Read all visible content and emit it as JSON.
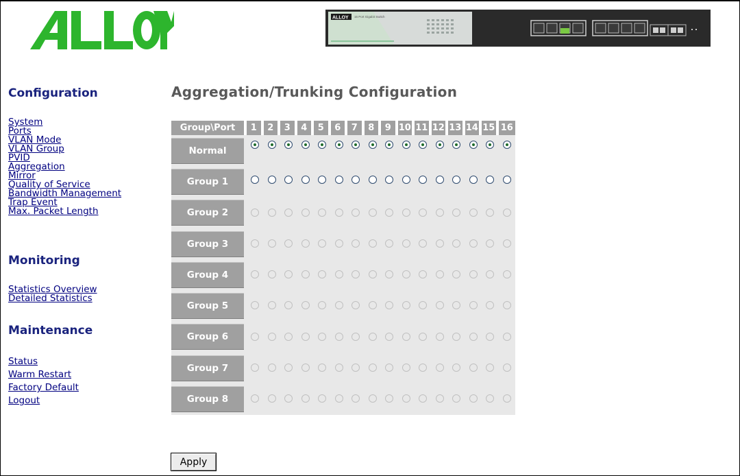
{
  "logo": {
    "text": "ALLOY",
    "color": "#2db52d"
  },
  "switch_image": {
    "label": "16 Port Gigabit Switch",
    "brand": "ALLOY"
  },
  "sidebar": {
    "configuration": {
      "heading": "Configuration",
      "links": [
        "System",
        "Ports",
        "VLAN Mode",
        "VLAN Group",
        "PVID",
        "Aggregation",
        "Mirror",
        "Quality of Service",
        "Bandwidth Management",
        "Trap Event",
        "Max. Packet Length"
      ]
    },
    "monitoring": {
      "heading": "Monitoring",
      "links": [
        "Statistics Overview",
        "Detailed Statistics"
      ]
    },
    "maintenance": {
      "heading": "Maintenance",
      "links": [
        "Status",
        "Warm Restart",
        "Factory Default",
        "Logout"
      ]
    }
  },
  "main": {
    "title": "Aggregation/Trunking Configuration",
    "table": {
      "corner_header": "Group\\Port",
      "ports": [
        "1",
        "2",
        "3",
        "4",
        "5",
        "6",
        "7",
        "8",
        "9",
        "10",
        "11",
        "12",
        "13",
        "14",
        "15",
        "16"
      ],
      "rows": [
        {
          "label": "Normal",
          "state": "checked"
        },
        {
          "label": "Group 1",
          "state": "enabled"
        },
        {
          "label": "Group 2",
          "state": "disabled"
        },
        {
          "label": "Group 3",
          "state": "disabled"
        },
        {
          "label": "Group 4",
          "state": "disabled"
        },
        {
          "label": "Group 5",
          "state": "disabled"
        },
        {
          "label": "Group 6",
          "state": "disabled"
        },
        {
          "label": "Group 7",
          "state": "disabled"
        },
        {
          "label": "Group 8",
          "state": "disabled"
        }
      ]
    },
    "apply_label": "Apply"
  },
  "colors": {
    "heading": "#1a237e",
    "link": "#000080",
    "title": "#595959",
    "header_bg": "#a0a0a0",
    "cell_bg": "#e8e8e8",
    "radio_dot": "#1f6b2b"
  }
}
